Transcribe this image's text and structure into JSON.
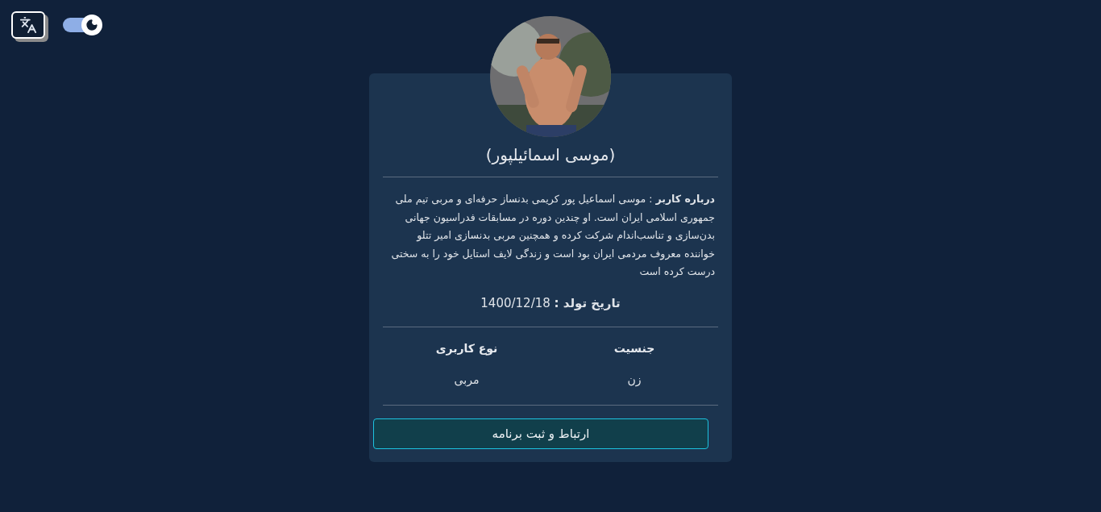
{
  "dark_mode_toggle": {
    "on": true
  },
  "profile": {
    "name": "(موسی اسمائیلپور)",
    "about": "**درباره کاربر** : موسی اسماعیل پور کریمی بدنساز حرفه‌ای و مربی تیم ملی جمهوری اسلامی ایران است. او چندین دوره در مسابقات فدراسیون جهانی بدن‌سازی و تناسب‌اندام شرکت کرده و همچنین مربی بدنسازی امیر تتلو خواننده معروف مردمی ایران بود است و زندگی لایف استایل خود را به سختی درست کرده است",
    "birth_date": "**تاریخ تولد :** 1400/12/18",
    "fields": [
      {
        "label": "جنسیت",
        "value": "زن"
      },
      {
        "label": "نوع کاربری",
        "value": "مربی"
      }
    ],
    "button": "ارتباط و ثبت برنامه"
  }
}
